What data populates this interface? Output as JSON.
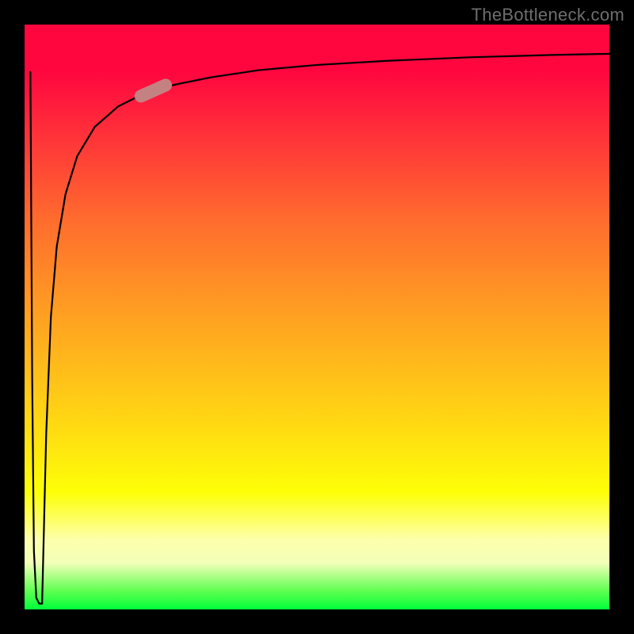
{
  "watermark": "TheBottleneck.com",
  "chart_data": {
    "type": "line",
    "title": "",
    "xlabel": "",
    "ylabel": "",
    "xlim": [
      0,
      100
    ],
    "ylim": [
      0,
      100
    ],
    "grid": false,
    "legend": false,
    "gradient_stops": [
      {
        "pct": 0,
        "color": "#ff063f"
      },
      {
        "pct": 8,
        "color": "#ff063f"
      },
      {
        "pct": 18,
        "color": "#ff2e3a"
      },
      {
        "pct": 33,
        "color": "#ff6a2e"
      },
      {
        "pct": 48,
        "color": "#ff9b23"
      },
      {
        "pct": 70,
        "color": "#ffde11"
      },
      {
        "pct": 80,
        "color": "#fdff07"
      },
      {
        "pct": 85,
        "color": "#fdff6b"
      },
      {
        "pct": 88,
        "color": "#fdffab"
      },
      {
        "pct": 92,
        "color": "#f3ffb8"
      },
      {
        "pct": 97,
        "color": "#5bff4f"
      },
      {
        "pct": 100,
        "color": "#00ff3a"
      }
    ],
    "series": [
      {
        "name": "curve",
        "x": [
          1.0,
          1.3,
          1.6,
          2.0,
          2.5,
          3.0,
          3.0,
          3.7,
          4.5,
          5.5,
          7.0,
          9.0,
          12.0,
          16.0,
          21.0,
          26.0,
          32.0,
          40.0,
          50.0,
          62.0,
          76.0,
          90.0,
          100.0
        ],
        "y": [
          92.0,
          40.0,
          10.0,
          2.0,
          1.0,
          1.0,
          1.0,
          30.0,
          50.0,
          62.0,
          71.0,
          77.5,
          82.5,
          86.0,
          88.5,
          89.8,
          91.0,
          92.2,
          93.1,
          93.8,
          94.4,
          94.8,
          95.0
        ]
      }
    ],
    "marker": {
      "x": 22.0,
      "y": 88.7,
      "length": 6.8,
      "width": 2.2,
      "angle_deg": -24.0,
      "color": "#c48181"
    }
  }
}
